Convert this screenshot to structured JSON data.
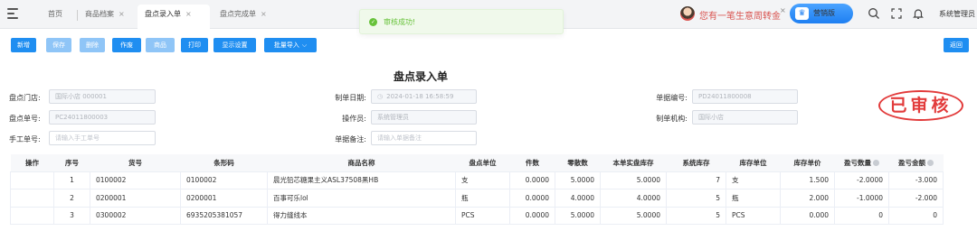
{
  "tabs": [
    {
      "label": "首页",
      "closable": false,
      "active": false
    },
    {
      "label": "商品档案",
      "closable": true,
      "active": false
    },
    {
      "label": "盘点录入单",
      "closable": true,
      "active": true
    },
    {
      "label": "盘点完成单",
      "closable": true,
      "active": false
    }
  ],
  "toast": {
    "message": "审核成功!",
    "color": "#67c23a"
  },
  "header": {
    "advisor_text": "您有一笔生意周转金",
    "edition_label": "营销版",
    "user_name": "系统管理员",
    "close_glyph": "×"
  },
  "toolbar": {
    "buttons": [
      {
        "label": "新增",
        "enabled": true
      },
      {
        "label": "保存",
        "enabled": false
      },
      {
        "label": "删除",
        "enabled": false
      },
      {
        "label": "作废",
        "enabled": true
      },
      {
        "label": "商品",
        "enabled": false
      },
      {
        "label": "打印",
        "enabled": true
      },
      {
        "label": "显示设置",
        "enabled": true
      },
      {
        "label": "批量导入",
        "enabled": true
      }
    ],
    "back_label": "返回"
  },
  "form": {
    "title": "盘点录入单",
    "stamp": "已审核",
    "store_label": "盘点门店:",
    "store_value": "国际小店 000001",
    "date_label": "制单日期:",
    "date_value": "2024-01-18 16:58:59",
    "bill_no_label": "单据编号:",
    "bill_no_value": "PD24011800008",
    "check_no_label": "盘点单号:",
    "check_no_value": "PC24011800003",
    "operator_label": "操作员:",
    "operator_value": "系统管理员",
    "org_label": "制单机构:",
    "org_value": "国际小店",
    "manual_no_label": "手工单号:",
    "manual_no_placeholder": "请输入手工单号",
    "remark_label": "单据备注:",
    "remark_placeholder": "请输入单据备注"
  },
  "table": {
    "headers": [
      "操作",
      "序号",
      "货号",
      "条形码",
      "商品名称",
      "盘点单位",
      "件数",
      "零散数",
      "本单实盘库存",
      "系统库存",
      "库存单位",
      "库存单价",
      "盈亏数量",
      "盈亏金额"
    ],
    "rows": [
      [
        "",
        "1",
        "0100002",
        "0100002",
        "晨光铅芯糖果主义ASL37508黑HB",
        "支",
        "0.0000",
        "5.0000",
        "5.0000",
        "7",
        "支",
        "1.500",
        "-2.0000",
        "-3.000"
      ],
      [
        "",
        "2",
        "0200001",
        "0200001",
        "百事可乐lol",
        "瓶",
        "0.0000",
        "4.0000",
        "4.0000",
        "5",
        "瓶",
        "2.000",
        "-1.0000",
        "-2.000"
      ],
      [
        "",
        "3",
        "0300002",
        "6935205381057",
        "得力缝线本",
        "PCS",
        "0.0000",
        "5.0000",
        "5.0000",
        "5",
        "PCS",
        "0.000",
        "0",
        "0"
      ]
    ]
  },
  "colors": {
    "primary": "#1f8ef1",
    "negative": "#e23b3b",
    "stamp": "#e23b3b",
    "advisor": "#d9534f"
  }
}
